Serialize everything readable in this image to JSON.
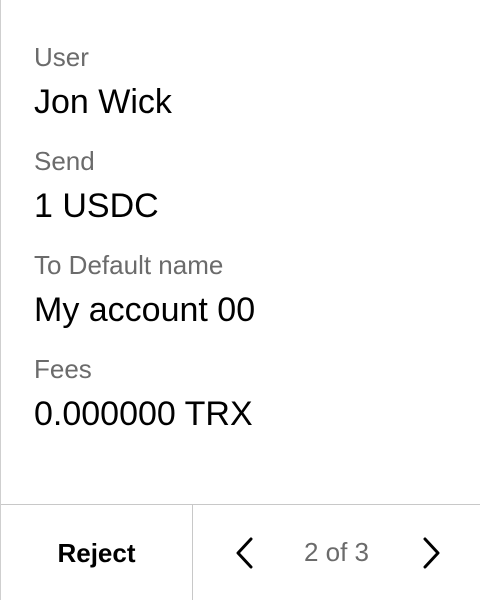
{
  "transaction": {
    "fields": [
      {
        "label": "User",
        "value": "Jon Wick"
      },
      {
        "label": "Send",
        "value": "1 USDC"
      },
      {
        "label": "To Default name",
        "value": "My account 00"
      },
      {
        "label": "Fees",
        "value": "0.000000 TRX"
      }
    ]
  },
  "footer": {
    "reject_label": "Reject",
    "pager": {
      "text": "2 of 3",
      "prev_icon": "chevron-left-icon",
      "next_icon": "chevron-right-icon"
    }
  }
}
